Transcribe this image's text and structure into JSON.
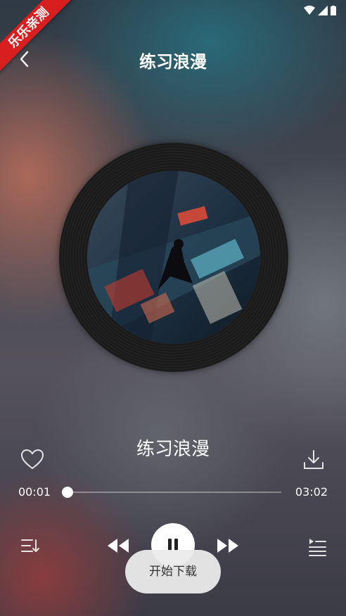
{
  "status_bar": {
    "icons": [
      "wifi-icon",
      "signal-icon",
      "battery-icon"
    ]
  },
  "ribbon": {
    "label": "乐乐亲测"
  },
  "header": {
    "title": "练习浪漫",
    "back_icon": "chevron-left-icon"
  },
  "player": {
    "song_title": "练习浪漫",
    "current_time": "00:01",
    "total_time": "03:02",
    "progress": 0.005,
    "like_icon": "heart-outline-icon",
    "download_icon": "download-icon",
    "controls": {
      "playlist_icon": "playlist-icon",
      "prev_icon": "rewind-icon",
      "play_state_icon": "pause-icon",
      "next_icon": "fast-forward-icon",
      "queue_icon": "queue-icon"
    }
  },
  "toast": {
    "text": "开始下载"
  },
  "colors": {
    "ribbon": "#d81e1e",
    "record": "#1a1a1a",
    "toast_bg": "#ebebeb"
  }
}
